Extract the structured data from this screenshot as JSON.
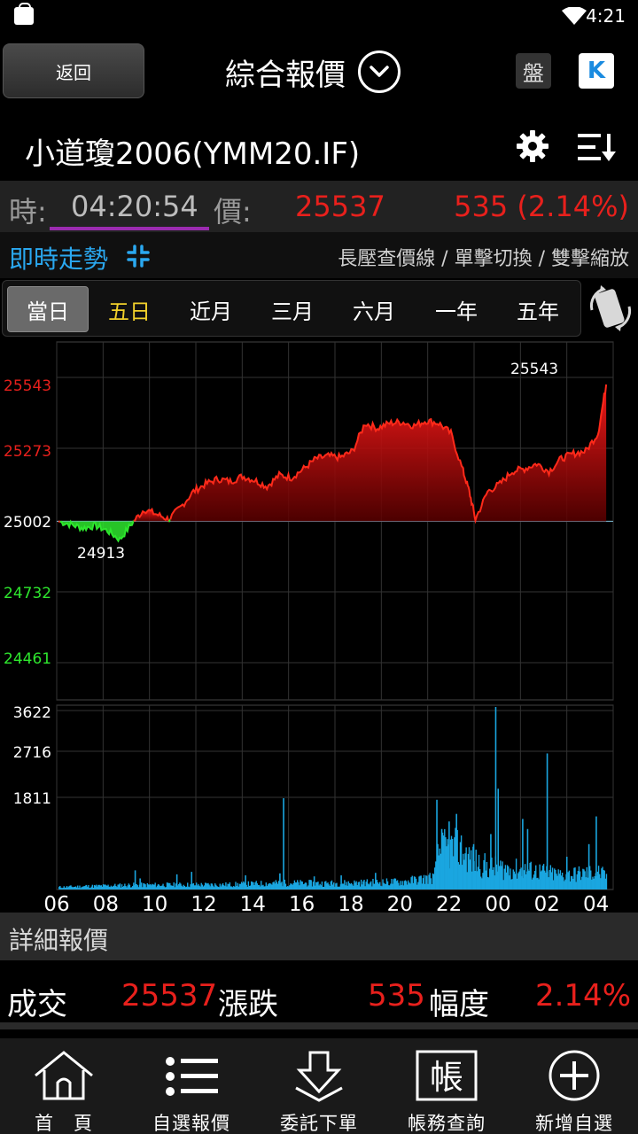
{
  "status_bar": {
    "time": "4:21"
  },
  "header": {
    "back_label": "返回",
    "title": "綜合報價",
    "pan_label": "盤",
    "k_label": "K"
  },
  "stock": {
    "name": "小道瓊2006(YMM20.IF)"
  },
  "quote": {
    "time_label": "時:",
    "time_value": "04:20:54",
    "price_label": "價:",
    "price_value": "25537",
    "change_value": "535 (2.14%)"
  },
  "trend": {
    "title": "即時走勢",
    "hint": "長壓查價線 / 單擊切換 / 雙擊縮放"
  },
  "tabs": [
    {
      "label": "當日",
      "state": "active"
    },
    {
      "label": "五日",
      "state": "highlight"
    },
    {
      "label": "近月",
      "state": "normal"
    },
    {
      "label": "三月",
      "state": "normal"
    },
    {
      "label": "六月",
      "state": "normal"
    },
    {
      "label": "一年",
      "state": "normal"
    },
    {
      "label": "五年",
      "state": "normal"
    }
  ],
  "colors": {
    "up": "#e8201c",
    "down": "#2ee62e",
    "volume": "#1aa6e0",
    "accent": "#2aa8f0"
  },
  "chart_data": [
    {
      "type": "area",
      "ylim": [
        24461,
        25543
      ],
      "reference": 25002,
      "y_ticks": [
        {
          "value": "25543",
          "color": "up"
        },
        {
          "value": "25273",
          "color": "up"
        },
        {
          "value": "25002",
          "color": "neutral"
        },
        {
          "value": "24732",
          "color": "down"
        },
        {
          "value": "24461",
          "color": "down"
        }
      ],
      "high_label": "25543",
      "low_label": "24913",
      "series": [
        {
          "x": [
            "06:00",
            "06:30",
            "07:00",
            "07:30",
            "08:00",
            "08:30",
            "09:00",
            "09:30",
            "10:00",
            "10:30",
            "11:00",
            "11:30",
            "12:00",
            "12:30",
            "13:00",
            "13:30",
            "14:00",
            "14:30",
            "15:00",
            "15:30",
            "16:00",
            "16:30",
            "17:00",
            "17:30",
            "18:00",
            "18:30",
            "19:00",
            "19:30",
            "20:00",
            "20:30",
            "21:00",
            "21:30",
            "22:00",
            "22:30",
            "22:45",
            "23:00",
            "23:30",
            "00:00",
            "00:30",
            "01:00",
            "01:30",
            "02:00",
            "02:30",
            "03:00",
            "03:30",
            "04:00",
            "04:20"
          ],
          "values": [
            25002,
            24990,
            24975,
            24985,
            24965,
            24930,
            24995,
            25050,
            25030,
            25010,
            25060,
            25120,
            25150,
            25170,
            25160,
            25180,
            25165,
            25140,
            25185,
            25175,
            25210,
            25250,
            25260,
            25255,
            25280,
            25390,
            25370,
            25390,
            25395,
            25380,
            25400,
            25390,
            25350,
            25200,
            25120,
            25010,
            25120,
            25150,
            25200,
            25210,
            25230,
            25200,
            25250,
            25270,
            25280,
            25350,
            25543
          ]
        }
      ]
    },
    {
      "type": "bar",
      "ylim": [
        0,
        3622
      ],
      "y_ticks": [
        "3622",
        "2716",
        "1811"
      ],
      "x_ticks": [
        "06",
        "08",
        "10",
        "12",
        "14",
        "16",
        "18",
        "20",
        "22",
        "00",
        "02",
        "04"
      ],
      "xlim": [
        6,
        28.35
      ],
      "spikes": [
        {
          "x": 7.1,
          "value": 90
        },
        {
          "x": 9.1,
          "value": 380
        },
        {
          "x": 9.3,
          "value": 220
        },
        {
          "x": 10.8,
          "value": 300
        },
        {
          "x": 11.4,
          "value": 350
        },
        {
          "x": 13.6,
          "value": 280
        },
        {
          "x": 15.0,
          "value": 320
        },
        {
          "x": 15.15,
          "value": 1811
        },
        {
          "x": 16.4,
          "value": 260
        },
        {
          "x": 17.5,
          "value": 280
        },
        {
          "x": 18.9,
          "value": 330
        },
        {
          "x": 21.4,
          "value": 1780
        },
        {
          "x": 21.6,
          "value": 1200
        },
        {
          "x": 21.9,
          "value": 1350
        },
        {
          "x": 22.2,
          "value": 1500
        },
        {
          "x": 22.9,
          "value": 900
        },
        {
          "x": 23.6,
          "value": 1100
        },
        {
          "x": 23.8,
          "value": 3622
        },
        {
          "x": 23.9,
          "value": 2000
        },
        {
          "x": 24.9,
          "value": 1400
        },
        {
          "x": 25.1,
          "value": 1200
        },
        {
          "x": 25.9,
          "value": 2700
        },
        {
          "x": 26.7,
          "value": 650
        },
        {
          "x": 27.6,
          "value": 900
        },
        {
          "x": 27.9,
          "value": 1450
        }
      ],
      "base_profile": [
        {
          "x": 6.0,
          "value": 60
        },
        {
          "x": 9.0,
          "value": 110
        },
        {
          "x": 13.0,
          "value": 120
        },
        {
          "x": 15.0,
          "value": 160
        },
        {
          "x": 17.0,
          "value": 150
        },
        {
          "x": 20.0,
          "value": 190
        },
        {
          "x": 21.3,
          "value": 300
        },
        {
          "x": 21.5,
          "value": 950
        },
        {
          "x": 22.3,
          "value": 1000
        },
        {
          "x": 22.9,
          "value": 700
        },
        {
          "x": 23.5,
          "value": 550
        },
        {
          "x": 24.5,
          "value": 500
        },
        {
          "x": 25.5,
          "value": 450
        },
        {
          "x": 26.5,
          "value": 350
        },
        {
          "x": 28.0,
          "value": 420
        },
        {
          "x": 28.35,
          "value": 300
        }
      ]
    }
  ],
  "detail": {
    "title": "詳細報價",
    "trade_label": "成交",
    "trade_value": "25537",
    "change_label": "漲跌",
    "change_value": "535",
    "range_label": "幅度",
    "range_value": "2.14%"
  },
  "nav": [
    {
      "label": "首　頁",
      "icon": "home-icon"
    },
    {
      "label": "自選報價",
      "icon": "list-icon"
    },
    {
      "label": "委託下單",
      "icon": "order-icon"
    },
    {
      "label": "帳務查詢",
      "icon": "account-icon"
    },
    {
      "label": "新增自選",
      "icon": "add-icon"
    }
  ]
}
